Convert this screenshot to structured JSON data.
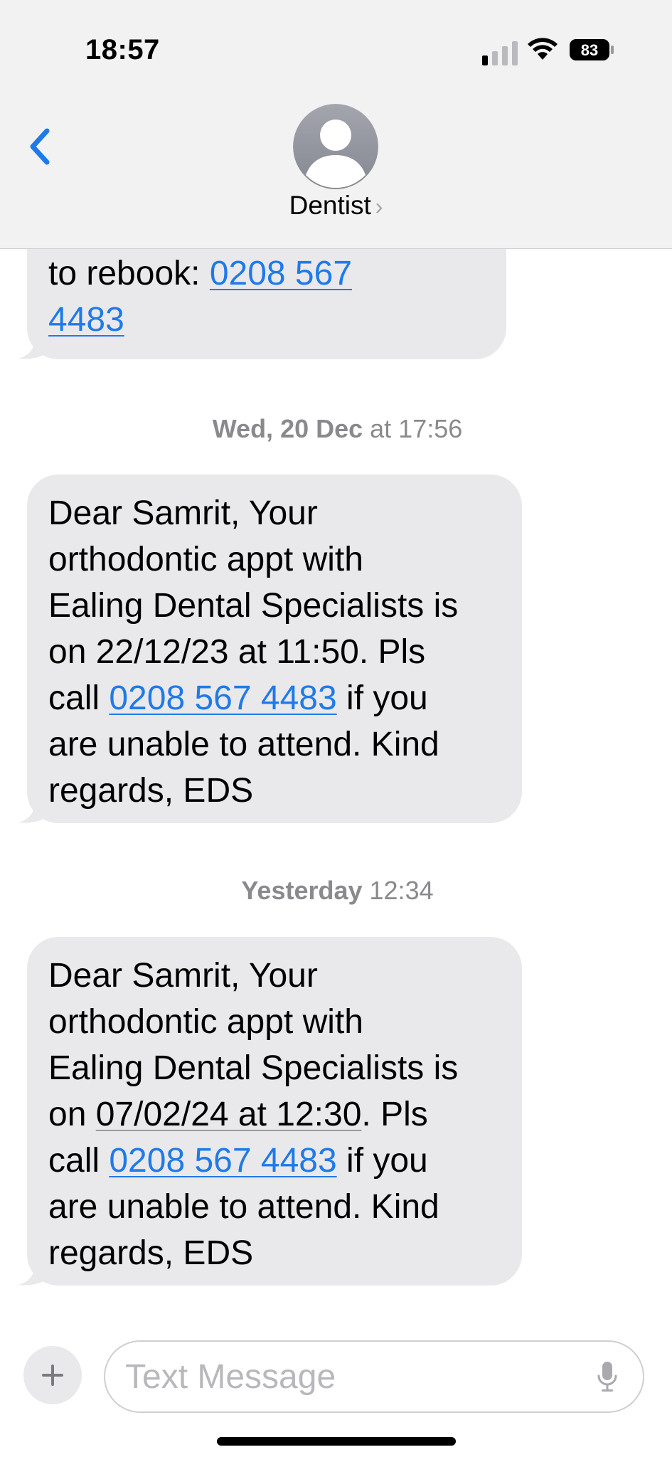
{
  "status_bar": {
    "time": "18:57",
    "battery_level": "83",
    "signal_bars_on": 1,
    "signal_bars_total": 4
  },
  "header": {
    "back_icon": "chevron-left-icon",
    "avatar_icon": "person-silhouette-icon",
    "contact_name": "Dentist",
    "contact_chevron": "›",
    "accent_color": "#1f7ae9"
  },
  "messages": [
    {
      "partial_top": true,
      "line1_prefix": "to rebook: ",
      "link_part1": "0208 567",
      "link_part2": "4483"
    },
    {
      "timestamp_day": "Wed, 20 Dec",
      "timestamp_rest": " at 17:56",
      "lines": [
        "Dear Samrit, Your",
        "orthodontic appt with",
        "Ealing Dental Specialists is",
        "on 22/12/23 at 11:50. Pls"
      ],
      "call_prefix": "call ",
      "phone": "0208 567 4483",
      "call_suffix": " if you",
      "tail_lines": [
        "are unable to attend. Kind",
        "regards, EDS"
      ]
    },
    {
      "timestamp_day": "Yesterday",
      "timestamp_rest": " 12:34",
      "lines": [
        "Dear Samrit, Your",
        "orthodontic appt with",
        "Ealing Dental Specialists is"
      ],
      "date_prefix": "on ",
      "date_link": "07/02/24 at 12:30",
      "date_suffix": ". Pls",
      "call_prefix": "call ",
      "phone": "0208 567 4483",
      "call_suffix": " if you",
      "tail_lines": [
        "are unable to attend. Kind",
        "regards, EDS"
      ]
    }
  ],
  "composer": {
    "placeholder": "Text Message",
    "plus_icon": "plus-icon",
    "mic_icon": "microphone-icon"
  },
  "colors": {
    "bubble_gray": "#e9e9eb",
    "link_blue": "#1f7ae9",
    "timestamp_gray": "#8a8a8e"
  }
}
